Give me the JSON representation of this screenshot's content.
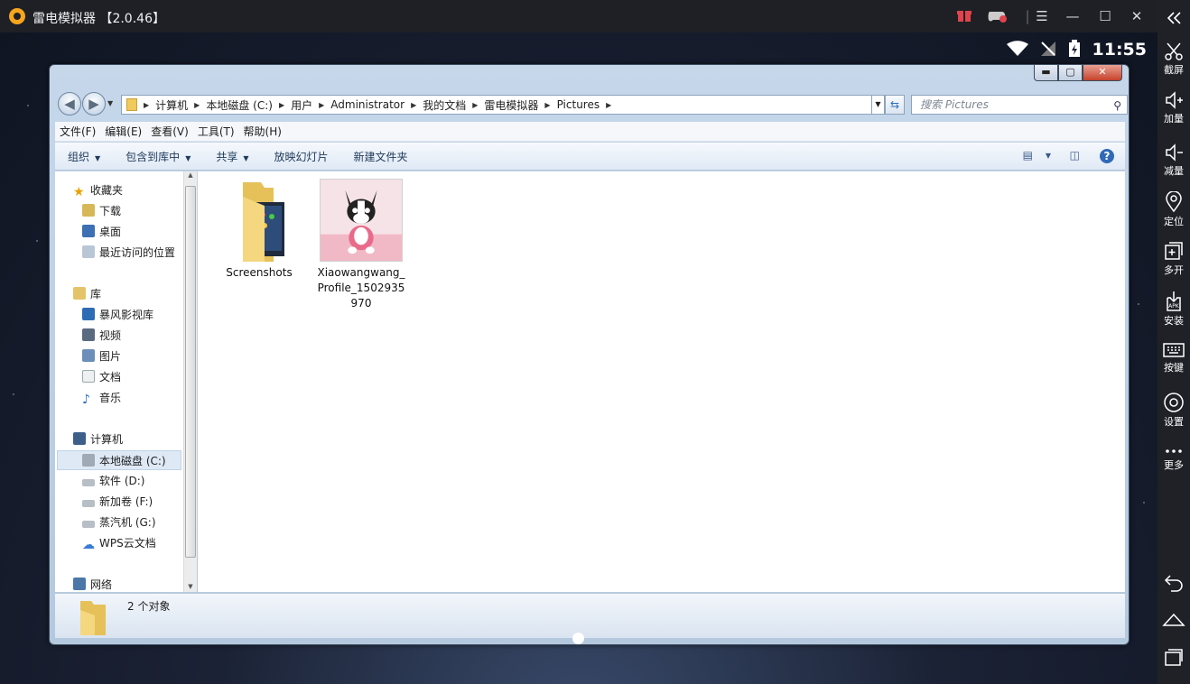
{
  "emulator": {
    "title": "雷电模拟器 【2.0.46】",
    "time": "11:55",
    "sidebar": [
      {
        "label": "截屏",
        "icon": "scissors-icon"
      },
      {
        "label": "加量",
        "icon": "volume-up-icon"
      },
      {
        "label": "减量",
        "icon": "volume-down-icon"
      },
      {
        "label": "定位",
        "icon": "location-icon"
      },
      {
        "label": "多开",
        "icon": "multi-instance-icon"
      },
      {
        "label": "安装",
        "icon": "apk-install-icon"
      },
      {
        "label": "按键",
        "icon": "keyboard-icon"
      },
      {
        "label": "设置",
        "icon": "gear-icon"
      },
      {
        "label": "更多",
        "icon": "more-icon"
      }
    ]
  },
  "explorer": {
    "breadcrumb": [
      "计算机",
      "本地磁盘 (C:)",
      "用户",
      "Administrator",
      "我的文档",
      "雷电模拟器",
      "Pictures"
    ],
    "search_placeholder": "搜索 Pictures",
    "menu": [
      "文件(F)",
      "编辑(E)",
      "查看(V)",
      "工具(T)",
      "帮助(H)"
    ],
    "commands": [
      "组织",
      "包含到库中",
      "共享",
      "放映幻灯片",
      "新建文件夹"
    ],
    "nav": {
      "favorites": {
        "label": "收藏夹",
        "items": [
          "下载",
          "桌面",
          "最近访问的位置"
        ]
      },
      "library": {
        "label": "库",
        "items": [
          "暴风影视库",
          "视频",
          "图片",
          "文档",
          "音乐"
        ]
      },
      "computer": {
        "label": "计算机",
        "items": [
          "本地磁盘 (C:)",
          "软件 (D:)",
          "新加卷 (F:)",
          "蒸汽机 (G:)",
          "WPS云文档"
        ]
      },
      "network": {
        "label": "网络"
      }
    },
    "files": [
      {
        "name": "Screenshots",
        "type": "folder"
      },
      {
        "name": "Xiaowangwang_\nProfile_1502935\n970",
        "type": "image"
      }
    ],
    "status_count": "2 个对象"
  }
}
